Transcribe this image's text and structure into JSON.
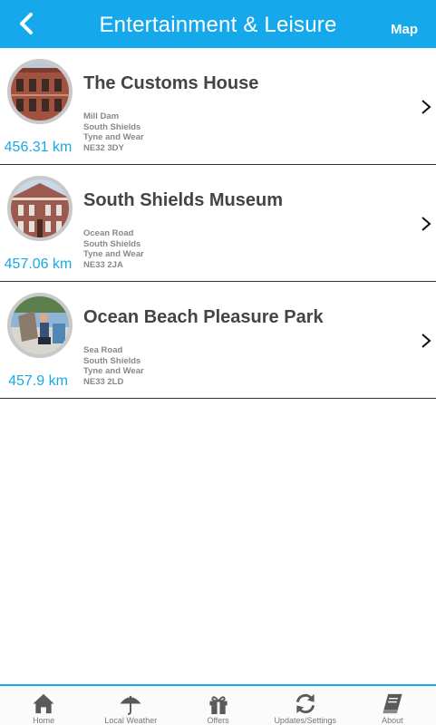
{
  "header": {
    "title": "Entertainment & Leisure",
    "back_icon": "chevron-left-icon",
    "map_label": "Map"
  },
  "colors": {
    "accent": "#15a8ea",
    "distance": "#18a9e5",
    "title_text": "#444444",
    "address_text": "#888888"
  },
  "items": [
    {
      "title": "The Customs House",
      "address": [
        "Mill Dam",
        "South Shields",
        "Tyne and Wear",
        "NE32 3DY"
      ],
      "distance": "456.31 km",
      "image_icon": "customs-house-photo"
    },
    {
      "title": "South Shields Museum",
      "address": [
        "Ocean Road",
        "South Shields",
        "Tyne and Wear",
        "NE33 2JA"
      ],
      "distance": "457.06 km",
      "image_icon": "museum-photo"
    },
    {
      "title": "Ocean Beach Pleasure Park",
      "address": [
        "Sea Road",
        "South Shields",
        "Tyne and Wear",
        "NE33 2LD"
      ],
      "distance": "457.9 km",
      "image_icon": "pleasure-park-photo"
    }
  ],
  "nav": [
    {
      "label": "Home",
      "icon": "home-icon"
    },
    {
      "label": "Local Weather",
      "icon": "umbrella-icon"
    },
    {
      "label": "Offers",
      "icon": "gift-icon"
    },
    {
      "label": "Updates/Settings",
      "icon": "refresh-icon"
    },
    {
      "label": "About",
      "icon": "book-icon"
    }
  ]
}
